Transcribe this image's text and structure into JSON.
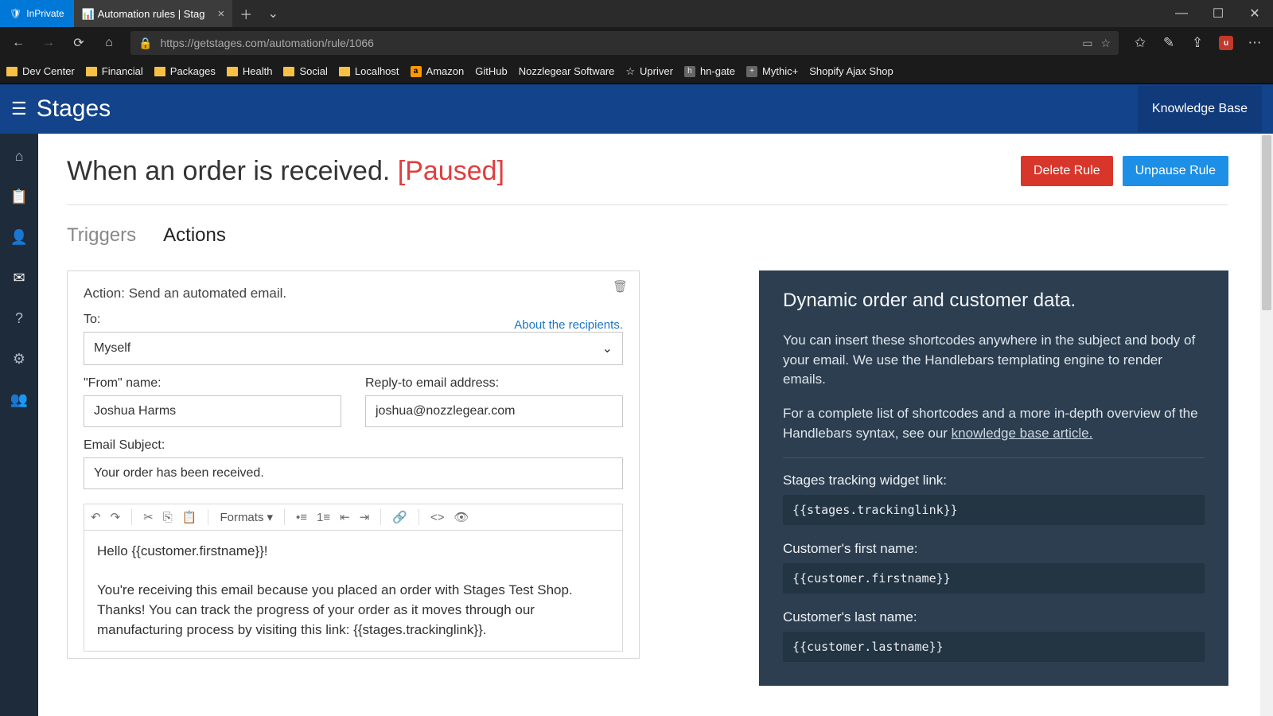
{
  "browser": {
    "inprivate_label": "InPrivate",
    "tab_title": "Automation rules | Stag",
    "url": "https://getstages.com/automation/rule/1066",
    "bookmarks": [
      "Dev Center",
      "Financial",
      "Packages",
      "Health",
      "Social",
      "Localhost",
      "Amazon",
      "GitHub",
      "Nozzlegear Software",
      "Upriver",
      "hn-gate",
      "Mythic+",
      "Shopify Ajax Shop"
    ]
  },
  "app": {
    "brand": "Stages",
    "knowledge_base": "Knowledge Base"
  },
  "header": {
    "title": "When an order is received.",
    "status": "[Paused]",
    "delete_btn": "Delete Rule",
    "unpause_btn": "Unpause Rule"
  },
  "tabs": {
    "triggers": "Triggers",
    "actions": "Actions"
  },
  "card": {
    "title": "Action: Send an automated email.",
    "to_label": "To:",
    "about_link": "About the recipients.",
    "to_value": "Myself",
    "from_label": "\"From\" name:",
    "from_value": "Joshua Harms",
    "reply_label": "Reply-to email address:",
    "reply_value": "joshua@nozzlegear.com",
    "subject_label": "Email Subject:",
    "subject_value": "Your order has been received.",
    "formats_label": "Formats",
    "body_line1": "Hello {{customer.firstname}}!",
    "body_line2": "You're receiving this email because you placed an order with Stages Test Shop. Thanks! You can track the progress of your order as it moves through our manufacturing process by visiting this link: {{stages.trackinglink}}."
  },
  "panel": {
    "title": "Dynamic order and customer data.",
    "p1": "You can insert these shortcodes anywhere in the subject and body of your email. We use the Handlebars templating engine to render emails.",
    "p2a": "For a complete list of shortcodes and a more in-depth overview of the Handlebars syntax, see our ",
    "p2link": "knowledge base article.",
    "sc": [
      {
        "label": "Stages tracking widget link:",
        "code": "{{stages.trackinglink}}"
      },
      {
        "label": "Customer's first name:",
        "code": "{{customer.firstname}}"
      },
      {
        "label": "Customer's last name:",
        "code": "{{customer.lastname}}"
      }
    ]
  }
}
